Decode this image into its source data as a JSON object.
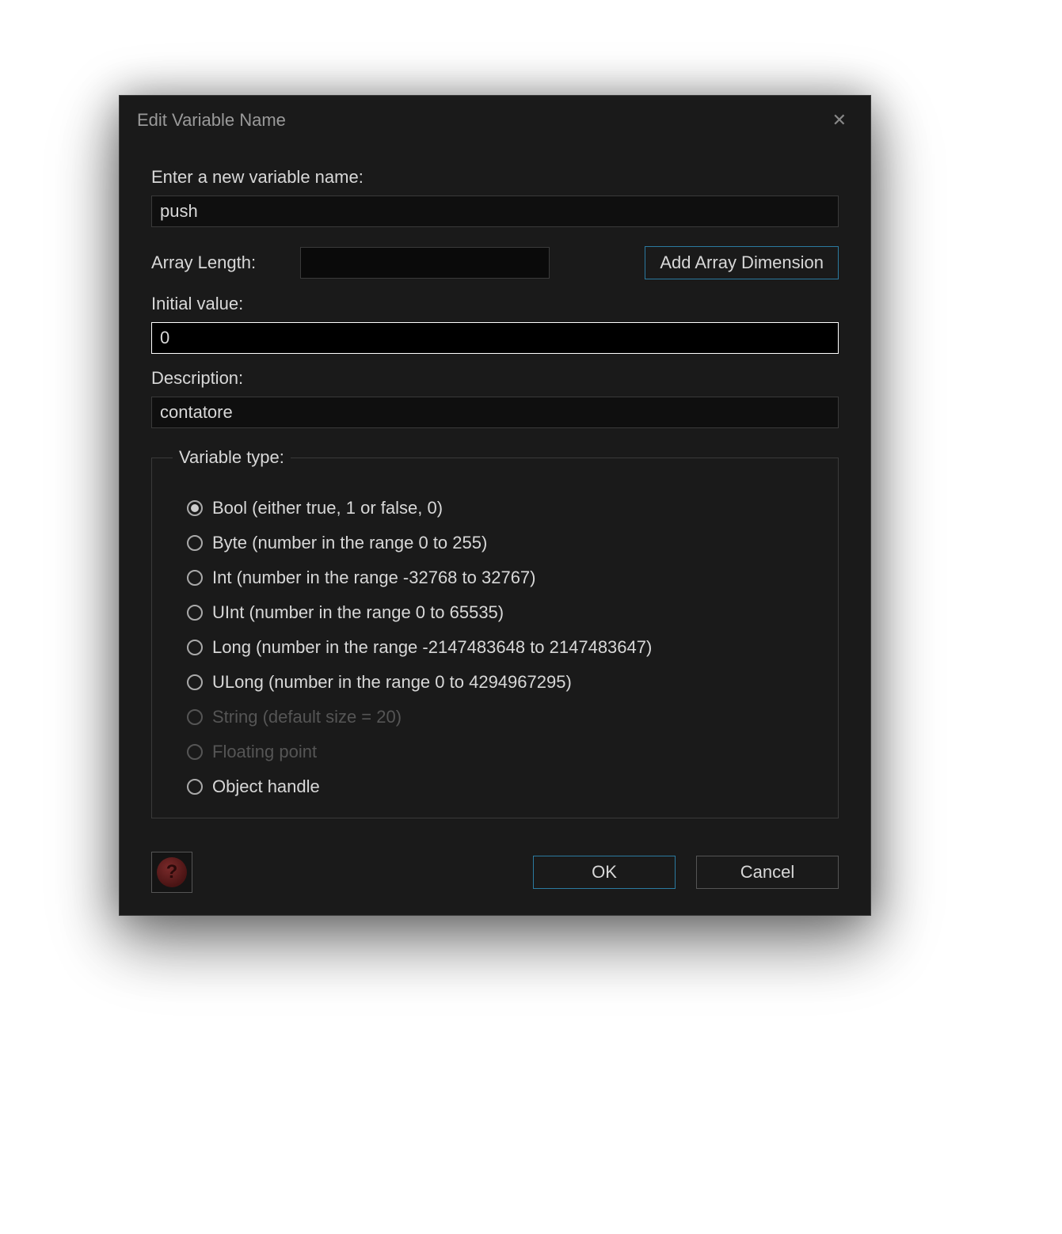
{
  "dialog": {
    "title": "Edit Variable Name",
    "labels": {
      "name_prompt": "Enter a new variable name:",
      "array_length": "Array Length:",
      "initial_value": "Initial value:",
      "description": "Description:",
      "variable_type": "Variable type:"
    },
    "inputs": {
      "name_value": "push",
      "array_length_value": "",
      "initial_value": "0",
      "description_value": "contatore"
    },
    "buttons": {
      "add_array_dimension": "Add Array Dimension",
      "ok": "OK",
      "cancel": "Cancel"
    },
    "help_glyph": "?",
    "variable_types": [
      {
        "label": "Bool (either true, 1 or false, 0)",
        "checked": true,
        "disabled": false
      },
      {
        "label": "Byte (number in the range 0 to 255)",
        "checked": false,
        "disabled": false
      },
      {
        "label": "Int (number in the range -32768 to 32767)",
        "checked": false,
        "disabled": false
      },
      {
        "label": "UInt (number in the range 0 to 65535)",
        "checked": false,
        "disabled": false
      },
      {
        "label": "Long (number in the range -2147483648 to 2147483647)",
        "checked": false,
        "disabled": false
      },
      {
        "label": "ULong (number in the range 0 to 4294967295)",
        "checked": false,
        "disabled": false
      },
      {
        "label": "String (default size = 20)",
        "checked": false,
        "disabled": true
      },
      {
        "label": "Floating point",
        "checked": false,
        "disabled": true
      },
      {
        "label": "Object handle",
        "checked": false,
        "disabled": false
      }
    ]
  }
}
